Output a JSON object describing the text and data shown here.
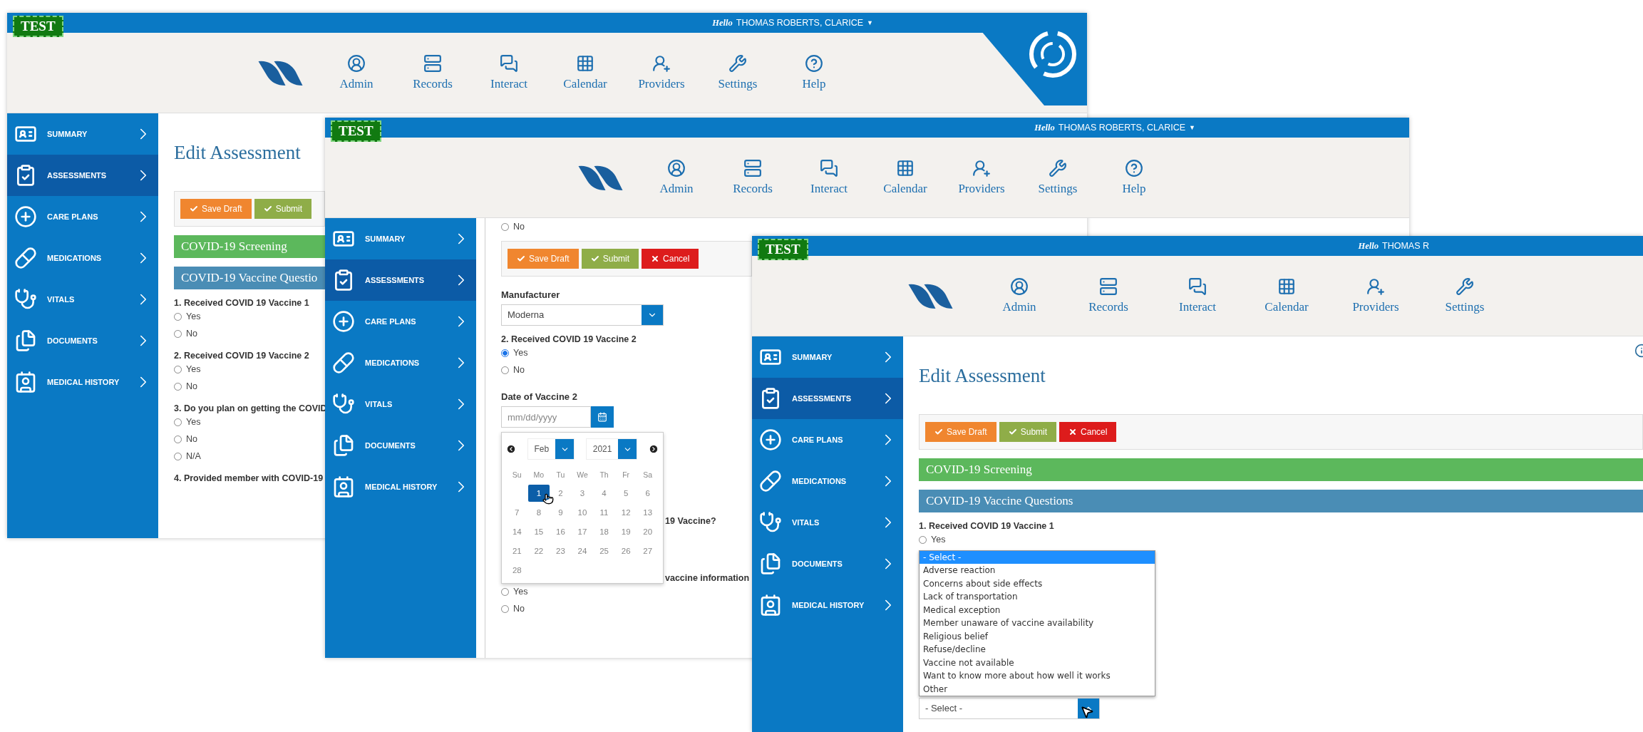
{
  "windows": [
    {
      "badge": "TEST",
      "greeting": "Hello",
      "user": "THOMAS ROBERTS, CLARICE",
      "user_caret": "▼",
      "nav": [
        "Admin",
        "Records",
        "Interact",
        "Calendar",
        "Providers",
        "Settings",
        "Help"
      ],
      "sidebar": [
        {
          "label": "SUMMARY",
          "selected": false
        },
        {
          "label": "ASSESSMENTS",
          "selected": true
        },
        {
          "label": "CARE PLANS",
          "selected": false
        },
        {
          "label": "MEDICATIONS",
          "selected": false
        },
        {
          "label": "VITALS",
          "selected": false
        },
        {
          "label": "DOCUMENTS",
          "selected": false
        },
        {
          "label": "MEDICAL HISTORY",
          "selected": false
        }
      ],
      "blocks": [
        {
          "kind": "title",
          "text": "Edit Assessment"
        },
        {
          "kind": "toolbar",
          "buttons": [
            {
              "kind": "save",
              "label": "Save Draft"
            },
            {
              "kind": "submit",
              "label": "Submit"
            }
          ]
        },
        {
          "kind": "section",
          "text": "COVID-19 Screening",
          "color": "#5cb85c"
        },
        {
          "kind": "section",
          "text": "COVID-19 Vaccine Questio",
          "color": "#4a8db5"
        },
        {
          "kind": "question",
          "text": "1. Received COVID 19 Vaccine 1",
          "options": [
            {
              "label": "Yes",
              "selected": false
            },
            {
              "label": "No",
              "selected": false
            }
          ]
        },
        {
          "kind": "question",
          "text": "2. Received COVID 19 Vaccine 2",
          "options": [
            {
              "label": "Yes",
              "selected": false
            },
            {
              "label": "No",
              "selected": false
            }
          ]
        },
        {
          "kind": "question",
          "text": "3. Do you plan on getting the COVID",
          "options": [
            {
              "label": "Yes",
              "selected": false
            },
            {
              "label": "No",
              "selected": false
            },
            {
              "label": "N/A",
              "selected": false
            }
          ]
        },
        {
          "kind": "question",
          "text": "4. Provided member with COVID-19"
        }
      ]
    },
    {
      "badge": "TEST",
      "greeting": "Hello",
      "user": "THOMAS ROBERTS, CLARICE",
      "user_caret": "▼",
      "nav": [
        "Admin",
        "Records",
        "Interact",
        "Calendar",
        "Providers",
        "Settings",
        "Help"
      ],
      "sidebar": [
        {
          "label": "SUMMARY",
          "selected": false
        },
        {
          "label": "ASSESSMENTS",
          "selected": true
        },
        {
          "label": "CARE PLANS",
          "selected": false
        },
        {
          "label": "MEDICATIONS",
          "selected": false
        },
        {
          "label": "VITALS",
          "selected": false
        },
        {
          "label": "DOCUMENTS",
          "selected": false
        },
        {
          "label": "MEDICAL HISTORY",
          "selected": false
        }
      ],
      "blocks": [
        {
          "kind": "question",
          "options": [
            {
              "label": "No",
              "selected": false
            }
          ]
        },
        {
          "kind": "toolbar",
          "buttons": [
            {
              "kind": "save",
              "label": "Save Draft"
            },
            {
              "kind": "submit",
              "label": "Submit"
            },
            {
              "kind": "cancel",
              "label": "Cancel"
            }
          ]
        },
        {
          "kind": "label",
          "text": "Manufacturer"
        },
        {
          "kind": "select",
          "value": "Moderna",
          "open": false
        },
        {
          "kind": "question",
          "text": "2. Received COVID 19 Vaccine 2",
          "options": [
            {
              "label": "Yes",
              "selected": true
            },
            {
              "label": "No",
              "selected": false
            }
          ]
        },
        {
          "kind": "label",
          "text": "Date of Vaccine 2"
        },
        {
          "kind": "date",
          "placeholder": "mm/dd/yyyy",
          "calendar": {
            "month": "Feb",
            "year": "2021",
            "weekdays": [
              "Su",
              "Mo",
              "Tu",
              "We",
              "Th",
              "Fr",
              "Sa"
            ],
            "weeks": [
              [
                {
                  "label": "1",
                  "selected": true
                },
                {
                  "label": "2",
                  "selected": false
                },
                {
                  "label": "3",
                  "selected": false
                },
                {
                  "label": "4",
                  "selected": false
                },
                {
                  "label": "5",
                  "selected": false
                },
                {
                  "label": "6",
                  "selected": false
                }
              ],
              [
                {
                  "label": "7",
                  "selected": false
                },
                {
                  "label": "8",
                  "selected": false
                },
                {
                  "label": "9",
                  "selected": false
                },
                {
                  "label": "10",
                  "selected": false
                },
                {
                  "label": "11",
                  "selected": false
                },
                {
                  "label": "12",
                  "selected": false
                },
                {
                  "label": "13",
                  "selected": false
                }
              ],
              [
                {
                  "label": "14",
                  "selected": false
                },
                {
                  "label": "15",
                  "selected": false
                },
                {
                  "label": "16",
                  "selected": false
                },
                {
                  "label": "17",
                  "selected": false
                },
                {
                  "label": "18",
                  "selected": false
                },
                {
                  "label": "19",
                  "selected": false
                },
                {
                  "label": "20",
                  "selected": false
                }
              ],
              [
                {
                  "label": "21",
                  "selected": false
                },
                {
                  "label": "22",
                  "selected": false
                },
                {
                  "label": "23",
                  "selected": false
                },
                {
                  "label": "24",
                  "selected": false
                },
                {
                  "label": "25",
                  "selected": false
                },
                {
                  "label": "26",
                  "selected": false
                },
                {
                  "label": "27",
                  "selected": false
                }
              ],
              [
                {
                  "label": "28",
                  "selected": false
                }
              ]
            ]
          }
        },
        {
          "kind": "fragment",
          "text": "19 Vaccine?"
        },
        {
          "kind": "fragment",
          "text": "vaccine information"
        },
        {
          "kind": "question",
          "options": [
            {
              "label": "Yes",
              "selected": false
            },
            {
              "label": "No",
              "selected": false
            }
          ]
        }
      ]
    },
    {
      "badge": "TEST",
      "greeting": "Hello",
      "user": "THOMAS R",
      "nav": [
        "Admin",
        "Records",
        "Interact",
        "Calendar",
        "Providers",
        "Settings"
      ],
      "sidebar": [
        {
          "label": "SUMMARY",
          "selected": false
        },
        {
          "label": "ASSESSMENTS",
          "selected": true
        },
        {
          "label": "CARE PLANS",
          "selected": false
        },
        {
          "label": "MEDICATIONS",
          "selected": false
        },
        {
          "label": "VITALS",
          "selected": false
        },
        {
          "label": "DOCUMENTS",
          "selected": false
        },
        {
          "label": "MEDICAL HISTORY",
          "selected": false
        }
      ],
      "blocks": [
        {
          "kind": "title",
          "text": "Edit Assessment"
        },
        {
          "kind": "toolbar",
          "buttons": [
            {
              "kind": "save",
              "label": "Save Draft"
            },
            {
              "kind": "submit",
              "label": "Submit"
            },
            {
              "kind": "cancel",
              "label": "Cancel"
            }
          ]
        },
        {
          "kind": "section",
          "text": "COVID-19 Screening",
          "color": "#5cb85c"
        },
        {
          "kind": "section",
          "text": "COVID-19 Vaccine Questions",
          "color": "#4a8db5"
        },
        {
          "kind": "question",
          "text": "1. Received COVID 19 Vaccine 1",
          "options": [
            {
              "label": "Yes",
              "selected": false
            }
          ]
        },
        {
          "kind": "select",
          "value": "- Select -",
          "open": true,
          "options": [
            {
              "label": "- Select -",
              "selected": true
            },
            {
              "label": "Adverse reaction",
              "selected": false
            },
            {
              "label": "Concerns about side effects",
              "selected": false
            },
            {
              "label": "Lack of transportation",
              "selected": false
            },
            {
              "label": "Medical exception",
              "selected": false
            },
            {
              "label": "Member unaware of vaccine availability",
              "selected": false
            },
            {
              "label": "Religious belief",
              "selected": false
            },
            {
              "label": "Refuse/decline",
              "selected": false
            },
            {
              "label": "Vaccine not available",
              "selected": false
            },
            {
              "label": "Want to know more about how well it works",
              "selected": false
            },
            {
              "label": "Other",
              "selected": false
            }
          ]
        }
      ]
    }
  ]
}
